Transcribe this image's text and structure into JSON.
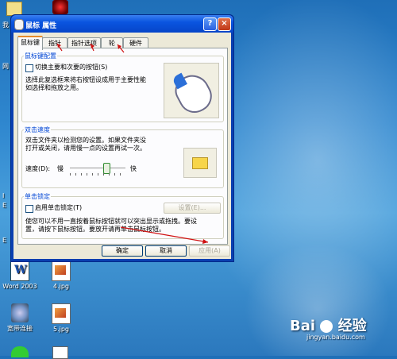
{
  "dialog": {
    "title": "鼠标 属性",
    "help_glyph": "?",
    "close_glyph": "×"
  },
  "tabs": [
    "鼠标键",
    "指针",
    "指针选项",
    "轮",
    "硬件"
  ],
  "button_config": {
    "legend": "鼠标键配置",
    "checkbox_label": "切换主要和次要的按钮(S)",
    "description": [
      "选择此复选框来将右按钮设成用于主要性能",
      "如选择和拖放之用。"
    ]
  },
  "double_click": {
    "legend": "双击速度",
    "description": [
      "双击文件夹以检测您的设置。如果文件夹没",
      "打开或关闭，请用慢一点的设置再试一次。"
    ],
    "speed_label": "速度(D):",
    "slow_label": "慢",
    "fast_label": "快",
    "speed_level": 0.6
  },
  "click_lock": {
    "legend": "单击锁定",
    "checkbox_label": "启用单击锁定(T)",
    "settings_label": "设置(E)...",
    "description": [
      "使您可以不用一直按着鼠标按钮就可以突出显示或拖拽。要设",
      "置，请按下鼠标按钮。要放开请再单击鼠标按钮。"
    ]
  },
  "footer": {
    "ok": "确定",
    "cancel": "取消",
    "apply": "应用(A)"
  },
  "desktop_icons": [
    {
      "label": "Word 2003",
      "icon": "word-icon"
    },
    {
      "label": "4.jpg",
      "icon": "image-file-icon"
    },
    {
      "label": "宽带连接",
      "icon": "network-icon"
    },
    {
      "label": "5.jpg",
      "icon": "image-file-icon"
    }
  ],
  "left_fragments": [
    "我",
    "网",
    "I",
    "E",
    "E"
  ],
  "watermark": {
    "brand": "Bai",
    "suffix": "经验",
    "url": "jingyan.baidu.com"
  }
}
